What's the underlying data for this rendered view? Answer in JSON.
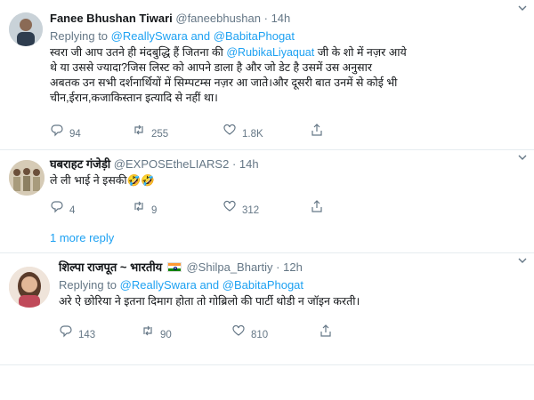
{
  "tweets": [
    {
      "name": "Fanee Bhushan Tiwari",
      "handle": "@faneebhushan",
      "separator": "·",
      "time": "14h",
      "replying_prefix": "Replying to",
      "replying_to": "@ReallySwara and @BabitaPhogat",
      "text_lines": [
        {
          "before": "स्वरा जी आप उतने ही मंदबुद्धि हैं जितना की ",
          "mention": "@RubikaLiyaquat",
          "after": " जी के शो में नज़र आये"
        },
        {
          "text": "थे या उससे ज्यादा?जिस लिस्ट को आपने डाला है और जो डेट है उसमें उस अनुसार"
        },
        {
          "text": "अबतक उन सभी दर्शनार्थियों में सिम्पटम्स नज़र आ जाते।और दूसरी बात उनमें से कोई भी"
        },
        {
          "text": "चीन,ईरान,कजाकिस्तान इत्यादि से नहीं था।"
        }
      ],
      "replies": "94",
      "retweets": "255",
      "likes": "1.8K"
    },
    {
      "name": "घबराहट गंजेड़ी",
      "handle": "@EXPOSEtheLIARS2",
      "separator": "·",
      "time": "14h",
      "text": "ले ली भाई ने इसकी🤣🤣",
      "replies": "4",
      "retweets": "9",
      "likes": "312"
    },
    {
      "name": "शिल्पा राजपूत ~ भारतीय",
      "handle": "@Shilpa_Bhartiy",
      "separator": "·",
      "time": "12h",
      "replying_prefix": "Replying to",
      "replying_to": "@ReallySwara and @BabitaPhogat",
      "text": "अरे ऐ छोरिया ने इतना दिमाग होता तो गोब्रिलो की पार्टी थोडी न जॉइन करती।",
      "replies": "143",
      "retweets": "90",
      "likes": "810"
    }
  ],
  "more_replies": "1 more reply",
  "icons": {
    "caret": "chevron-down-icon",
    "reply": "reply-icon",
    "retweet": "retweet-icon",
    "like": "heart-icon",
    "share": "share-icon",
    "flag": "india-flag-icon"
  },
  "colors": {
    "link": "#1da1f2",
    "muted": "#657786",
    "text": "#14171a",
    "divider": "#e6ecf0"
  }
}
